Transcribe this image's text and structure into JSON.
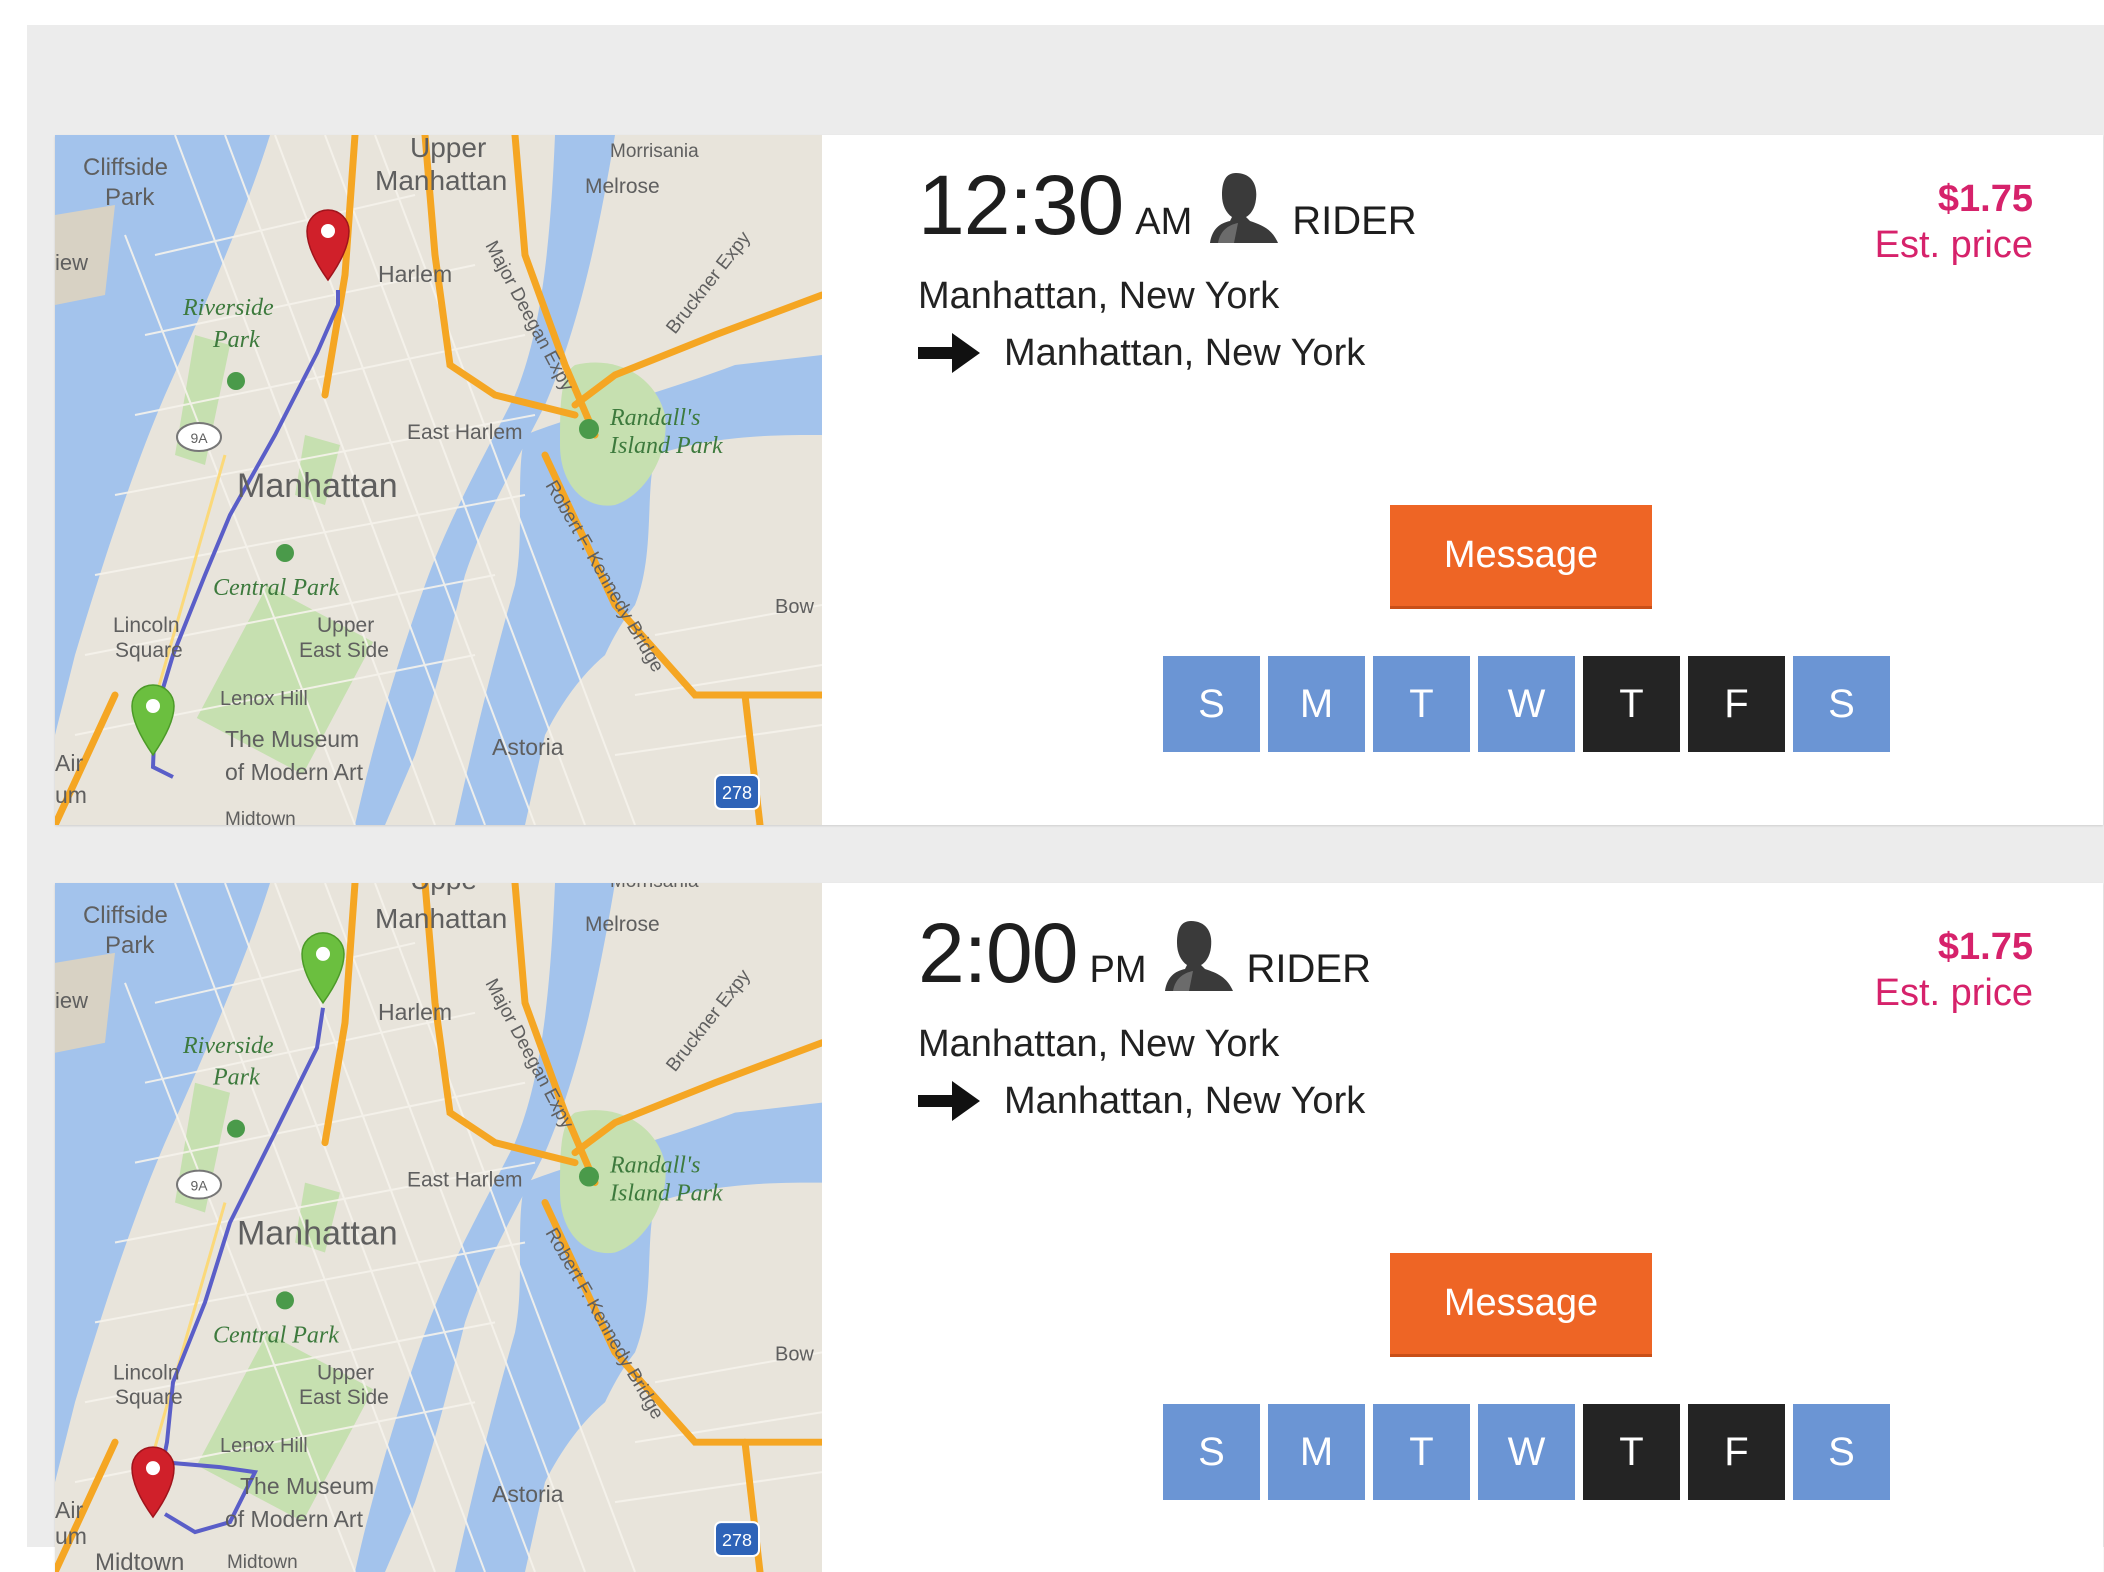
{
  "rides": [
    {
      "time": "12:30",
      "period": "AM",
      "role": "RIDER",
      "origin": "Manhattan, New York",
      "destination": "Manhattan, New York",
      "price": "$1.75",
      "price_caption": "Est. price",
      "message_label": "Message",
      "days": [
        {
          "label": "S",
          "active": false
        },
        {
          "label": "M",
          "active": false
        },
        {
          "label": "T",
          "active": false
        },
        {
          "label": "W",
          "active": false
        },
        {
          "label": "T",
          "active": true
        },
        {
          "label": "F",
          "active": true
        },
        {
          "label": "S",
          "active": false
        }
      ],
      "map": {
        "start_marker_color": "#6bbf3f",
        "end_marker_color": "#d0202a",
        "route_color": "#5a5ec8",
        "labels": {
          "cliffside": "Cliffside",
          "park": "Park",
          "upper": "Upper",
          "manhattan_small": "Manhattan",
          "morrisania": "Morrisania",
          "melrose": "Melrose",
          "view": "iew",
          "harlem": "Harlem",
          "riverside": "Riverside",
          "riverside_park": "Park",
          "major_deegan": "Major Deegan Expy",
          "bruckner": "Bruckner Expy",
          "randalls": "Randall's",
          "island_park": "Island Park",
          "east_harlem": "East Harlem",
          "route_9a": "9A",
          "manhattan": "Manhattan",
          "robert_kennedy": "Robert F. Kennedy Bridge",
          "central_park": "Central Park",
          "lincoln": "Lincoln",
          "square": "Square",
          "upper_east": "Upper",
          "east_side": "East Side",
          "bow": "Bow",
          "lenox_hill": "Lenox Hill",
          "museum_1": "The Museum",
          "museum_2": "of Modern Art",
          "astoria": "Astoria",
          "air": "Air",
          "um": "um",
          "midtown": "Midtown",
          "i278": "278"
        }
      }
    },
    {
      "time": "2:00",
      "period": "PM",
      "role": "RIDER",
      "origin": "Manhattan, New York",
      "destination": "Manhattan, New York",
      "price": "$1.75",
      "price_caption": "Est. price",
      "message_label": "Message",
      "days": [
        {
          "label": "S",
          "active": false
        },
        {
          "label": "M",
          "active": false
        },
        {
          "label": "T",
          "active": false
        },
        {
          "label": "W",
          "active": false
        },
        {
          "label": "T",
          "active": true
        },
        {
          "label": "F",
          "active": true
        },
        {
          "label": "S",
          "active": false
        }
      ],
      "map": {
        "start_marker_color": "#6bbf3f",
        "end_marker_color": "#d0202a",
        "route_color": "#5a5ec8",
        "labels": {
          "cliffside": "Cliffside",
          "park": "Park",
          "upper": "Uppe",
          "manhattan_small": "Manhattan",
          "morrisania": "Morrisania",
          "melrose": "Melrose",
          "view": "iew",
          "harlem": "Harlem",
          "riverside": "Riverside",
          "riverside_park": "Park",
          "major_deegan": "Major Deegan Expy",
          "bruckner": "Bruckner Expy",
          "randalls": "Randall's",
          "island_park": "Island Park",
          "east_harlem": "East Harlem",
          "route_9a": "9A",
          "manhattan": "Manhattan",
          "robert_kennedy": "Robert F. Kennedy Bridge",
          "central_park": "Central Park",
          "lincoln": "Lincoln",
          "square": "Square",
          "upper_east": "Upper",
          "east_side": "East Side",
          "bow": "Bow",
          "lenox_hill": "Lenox Hill",
          "museum_1": "The Museum",
          "museum_2": "of Modern Art",
          "astoria": "Astoria",
          "air": "Air",
          "um": "um",
          "midtown": "Midtown",
          "midtown_2": "Midtown",
          "i278": "278"
        }
      }
    }
  ]
}
